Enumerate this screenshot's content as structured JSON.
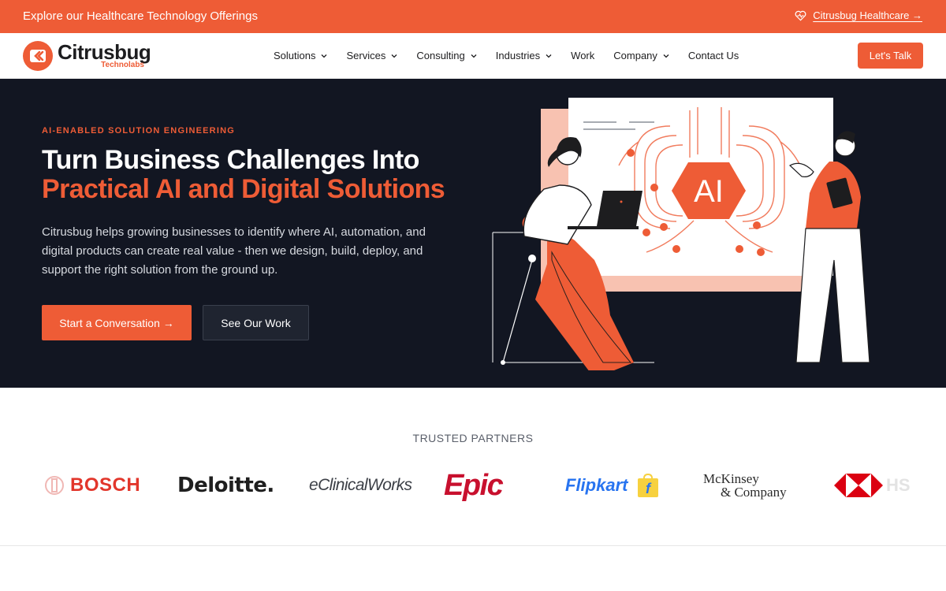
{
  "topbar": {
    "promo_text": "Explore our Healthcare Technology Offerings",
    "healthcare_link": "Citrusbug Healthcare →"
  },
  "brand": {
    "name": "Citrusbug",
    "sub": "Technolabs",
    "accent": "#ee5c36"
  },
  "nav": {
    "items": [
      {
        "label": "Solutions",
        "dropdown": true
      },
      {
        "label": "Services",
        "dropdown": true
      },
      {
        "label": "Consulting",
        "dropdown": true
      },
      {
        "label": "Industries",
        "dropdown": true
      },
      {
        "label": "Work",
        "dropdown": false
      },
      {
        "label": "Company",
        "dropdown": true
      },
      {
        "label": "Contact Us",
        "dropdown": false
      }
    ],
    "cta": "Let's Talk"
  },
  "hero": {
    "eyebrow": "AI-ENABLED SOLUTION ENGINEERING",
    "title_line1": "Turn Business Challenges Into",
    "title_line2": "Practical AI and Digital Solutions",
    "lead": "Citrusbug helps growing businesses to identify where AI, automation, and digital products can create real value - then we design, build, deploy, and support the right solution from the ground up.",
    "primary_cta": "Start a Conversation →",
    "secondary_cta": "See Our Work",
    "illustration_badge": "AI"
  },
  "partners": {
    "title": "TRUSTED PARTNERS",
    "logos": [
      {
        "name": "BOSCH"
      },
      {
        "name": "Deloitte."
      },
      {
        "name": "eClinicalWorks"
      },
      {
        "name": "Epic"
      },
      {
        "name": "Flipkart"
      },
      {
        "name": "McKinsey & Company",
        "line1": "McKinsey",
        "line2": "& Company"
      },
      {
        "name": "HSBC",
        "visible_text": "HS"
      }
    ]
  }
}
